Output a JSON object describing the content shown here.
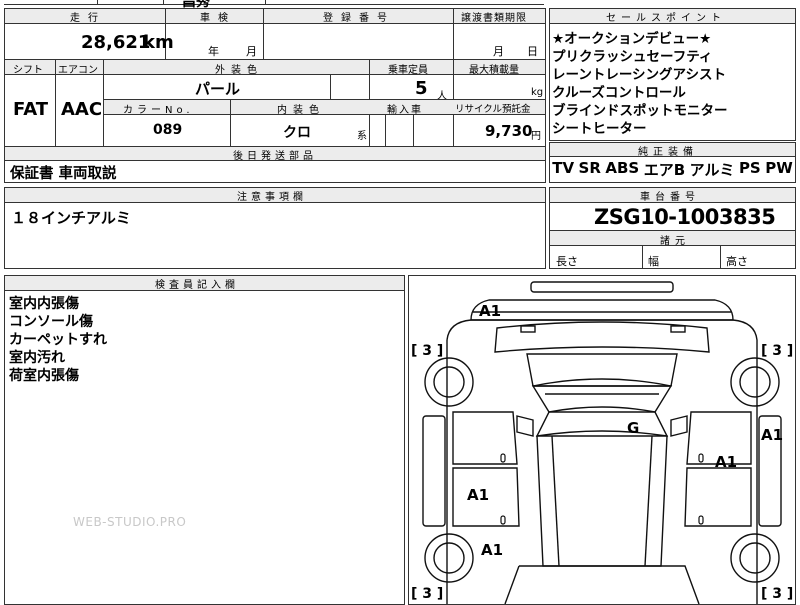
{
  "top_strip": {
    "partial_text": "昌秀"
  },
  "vehicle": {
    "mileage_label": "走行",
    "mileage_value": "28,621",
    "mileage_unit": "km",
    "inspection_label": "車検",
    "inspection_year_unit": "年",
    "inspection_month_unit": "月",
    "registration_label": "登録番号",
    "transfer_label": "譲渡書類期限",
    "transfer_month_unit": "月",
    "transfer_day_unit": "日",
    "shift_label": "シフト",
    "shift_value": "FAT",
    "ac_label": "エアコン",
    "ac_value": "AAC",
    "exterior_label": "外装色",
    "exterior_value": "パール",
    "capacity_label": "乗車定員",
    "capacity_value": "5",
    "capacity_unit": "人",
    "max_load_label": "最大積載量",
    "max_load_unit": "kg",
    "color_no_label": "カラーNo.",
    "color_no_value": "089",
    "interior_label": "内装色",
    "interior_value": "クロ",
    "interior_unit": "系",
    "import_label": "輸入車",
    "recycle_label": "リサイクル預託金",
    "recycle_value": "9,730",
    "recycle_unit": "円",
    "later_parts_label": "後日発送部品",
    "later_parts_value": "保証書 車両取説",
    "notes_label": "注意事項欄",
    "notes_value": "１８インチアルミ"
  },
  "sales_points": {
    "label": "セールスポイント",
    "items": [
      "★オークションデビュー★",
      "プリクラッシュセーフティ",
      "レーントレーシングアシスト",
      "クルーズコントロール",
      "ブラインドスポットモニター",
      "シートヒーター"
    ]
  },
  "equipment": {
    "label": "純正装備",
    "items": [
      "TV",
      "SR",
      "ABS",
      "エアB",
      "アルミ",
      "PS",
      "PW"
    ]
  },
  "chassis": {
    "label": "車台番号",
    "value": "ZSG10-1003835",
    "dims_label": "諸元",
    "length_label": "長さ",
    "width_label": "幅",
    "height_label": "高さ"
  },
  "inspector": {
    "label": "検査員記入欄",
    "items": [
      "室内内張傷",
      "コンソール傷",
      "カーペットすれ",
      "室内汚れ",
      "荷室内張傷"
    ]
  },
  "watermark": "WEB-STUDIO.PRO",
  "diagram": {
    "marks": [
      "A1",
      "G",
      "A1",
      "A1",
      "A1",
      "A1"
    ],
    "tire_marks": [
      "[ 3 ]",
      "[ 3 ]",
      "[ 3 ]",
      "[ 3 ]"
    ]
  }
}
